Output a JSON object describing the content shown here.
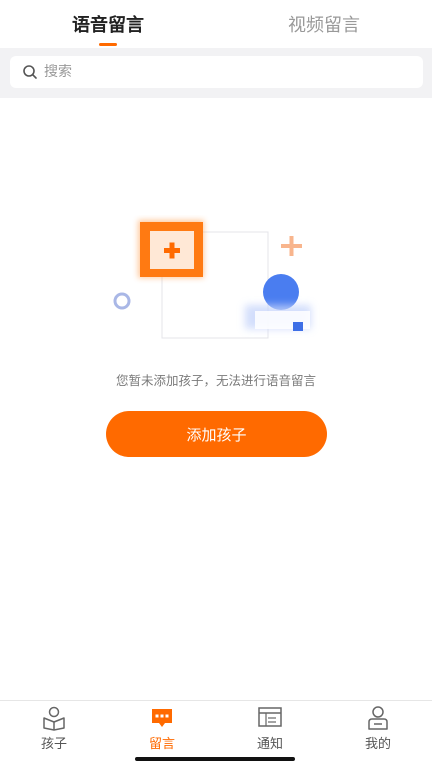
{
  "top_tabs": [
    {
      "label": "语音留言",
      "active": true
    },
    {
      "label": "视频留言",
      "active": false
    }
  ],
  "search": {
    "placeholder": "搜索",
    "value": "",
    "icon": "search-icon"
  },
  "empty_state": {
    "illustration": "add-child-illustration",
    "message": "您暂未添加孩子，无法进行语音留言",
    "button_label": "添加孩子"
  },
  "bottom_nav": [
    {
      "label": "孩子",
      "icon": "child-reading-icon",
      "active": false
    },
    {
      "label": "留言",
      "icon": "message-bubble-icon",
      "active": true
    },
    {
      "label": "通知",
      "icon": "notice-board-icon",
      "active": false
    },
    {
      "label": "我的",
      "icon": "profile-icon",
      "active": false
    }
  ],
  "colors": {
    "accent": "#ff6a00",
    "inactive": "#999999",
    "background": "#f2f2f4"
  }
}
